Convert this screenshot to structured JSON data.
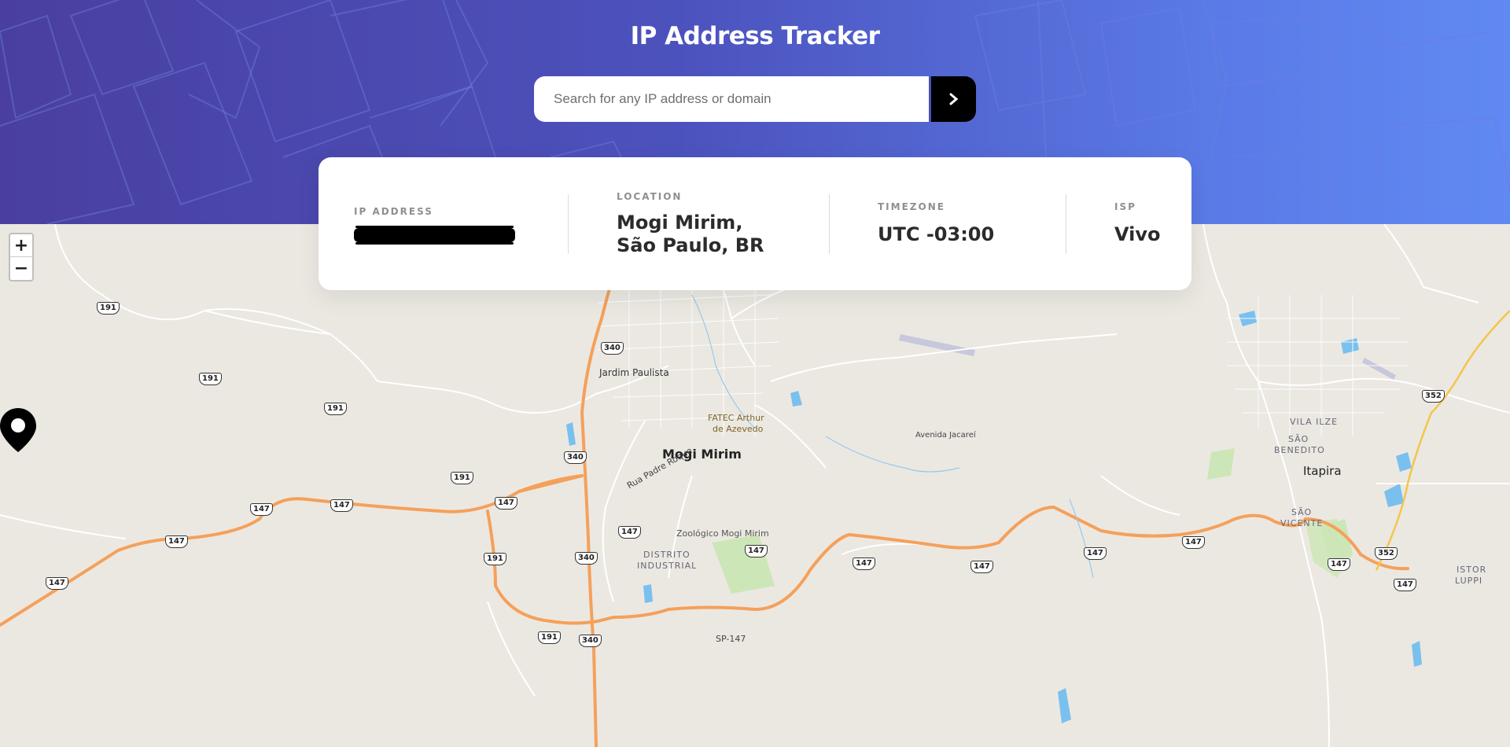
{
  "header": {
    "title": "IP Address Tracker",
    "search": {
      "placeholder": "Search for any IP address or domain",
      "value": "",
      "button_icon": "chevron-right-icon"
    }
  },
  "info": {
    "ip": {
      "label": "IP ADDRESS",
      "value_redacted": true
    },
    "location": {
      "label": "LOCATION",
      "line1": "Mogi Mirim,",
      "line2": "São Paulo, BR"
    },
    "timezone": {
      "label": "TIMEZONE",
      "value": "UTC -03:00"
    },
    "isp": {
      "label": "ISP",
      "value": "Vivo"
    }
  },
  "map": {
    "zoom_in": "+",
    "zoom_out": "−",
    "places": {
      "mogi_mirim": "Mogi Mirim",
      "jardim_paulista": "Jardim Paulista",
      "fatec_1": "FATEC Arthur",
      "fatec_2": "de Azevedo",
      "rua_padre_roque": "Rua Padre Roque",
      "zoologico": "Zoológico Mogi Mirim",
      "distrito_1": "DISTRITO",
      "distrito_2": "INDUSTRIAL",
      "avenida_jacarei": "Avenida Jacareí",
      "vila_ilze": "VILA ILZE",
      "sao_benedito_1": "SÃO",
      "sao_benedito_2": "BENEDITO",
      "itapira": "Itapira",
      "sao_vicente_1": "SÃO",
      "sao_vicente_2": "VICENTE",
      "istor_1": "ISTOR",
      "istor_2": "LUPPI",
      "sp147": "SP-147"
    },
    "shields": {
      "s191a": "191",
      "s191b": "191",
      "s191c": "191",
      "s191d": "191",
      "s191e": "191",
      "s191f": "191",
      "s147a": "147",
      "s147b": "147",
      "s147c": "147",
      "s147d": "147",
      "s147e": "147",
      "s147f": "147",
      "s147g": "147",
      "s147h": "147",
      "s147i": "147",
      "s147j": "147",
      "s147k": "147",
      "s147l": "147",
      "s147m": "147",
      "s340a": "340",
      "s340b": "340",
      "s340c": "340",
      "s340d": "340",
      "s352a": "352",
      "s352b": "352"
    },
    "colors": {
      "highway": "#f5a05a",
      "park": "#cde6b7",
      "water": "#79c0ee",
      "land": "#ebe8e2"
    }
  }
}
